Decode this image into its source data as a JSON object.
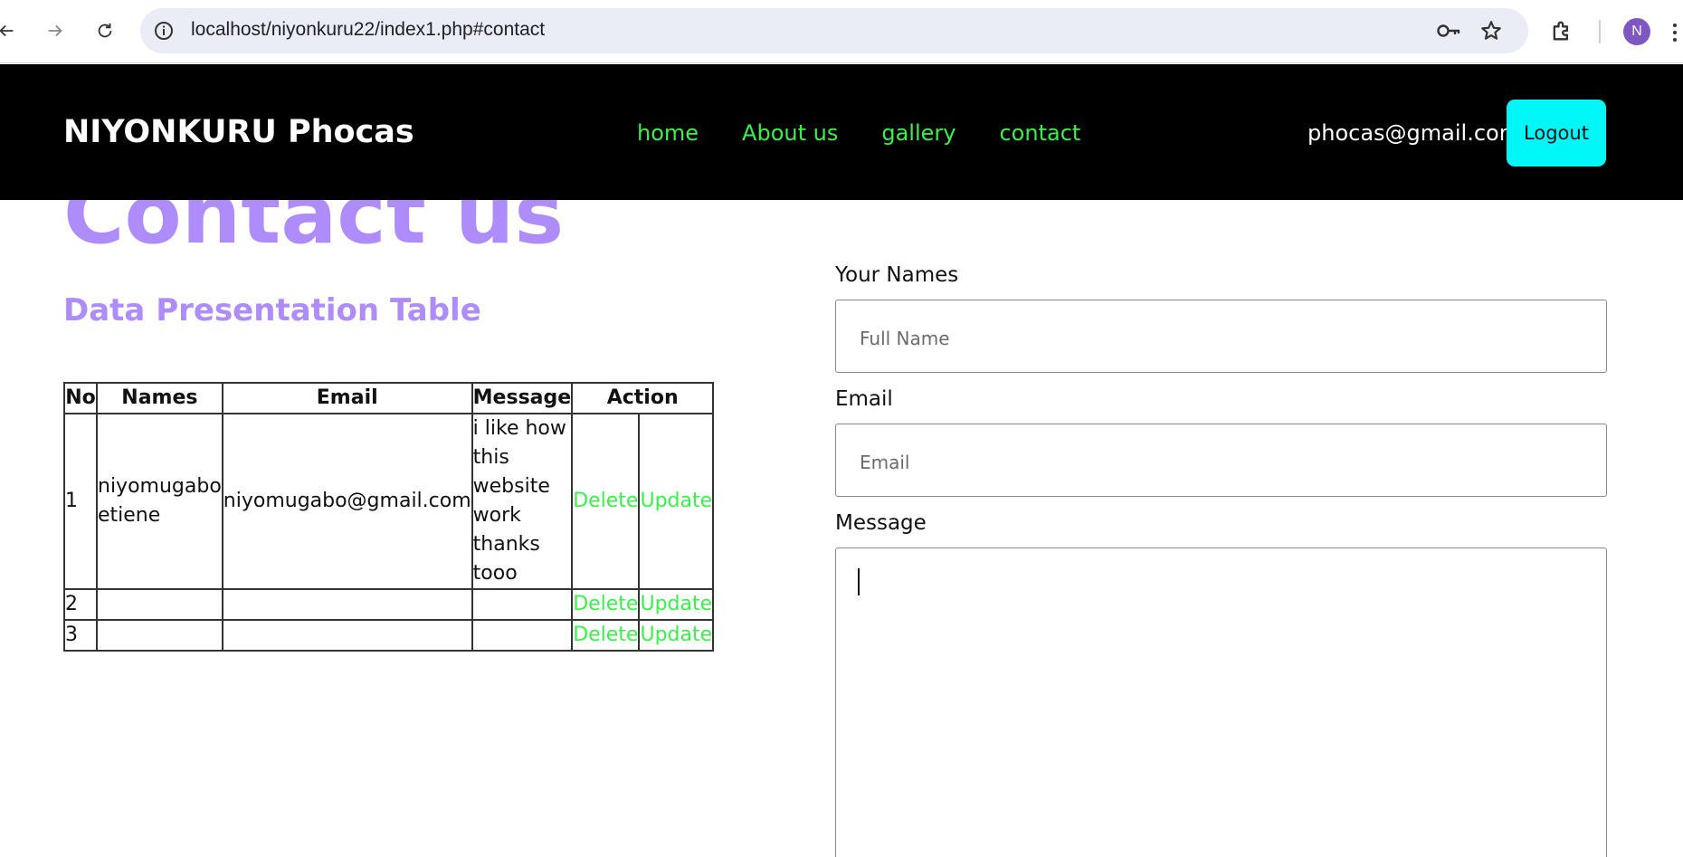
{
  "browser": {
    "url": "localhost/niyonkuru22/index1.php#contact",
    "profile_initial": "N",
    "icons": [
      "back-icon",
      "forward-icon",
      "reload-icon",
      "info-icon",
      "key-icon",
      "star-icon",
      "extensions-icon",
      "menu-icon"
    ]
  },
  "header": {
    "brand": "NIYONKURU Phocas",
    "nav": [
      "home",
      "About us",
      "gallery",
      "contact"
    ],
    "user_email": "phocas@gmail.com",
    "logout_label": "Logout",
    "colors": {
      "background": "#000000",
      "nav_link": "#3bf04a",
      "logout_bg": "#00f7f7"
    }
  },
  "main": {
    "title": "Contact us",
    "subtitle": "Data Presentation Table",
    "accent": "#ae8dfa",
    "table": {
      "headers": [
        "No",
        "Names",
        "Email",
        "Message",
        "Action"
      ],
      "rows": [
        {
          "no": "1",
          "names": "niyomugabo etiene",
          "email": "niyomugabo@gmail.com",
          "message": "i like how this website work thanks tooo",
          "delete": "Delete",
          "update": "Update"
        },
        {
          "no": "2",
          "names": "",
          "email": "",
          "message": "",
          "delete": "Delete",
          "update": "Update"
        },
        {
          "no": "3",
          "names": "",
          "email": "",
          "message": "",
          "delete": "Delete",
          "update": "Update"
        }
      ]
    }
  },
  "form": {
    "names_label": "Your Names",
    "names_placeholder": "Full Name",
    "email_label": "Email",
    "email_placeholder": "Email",
    "message_label": "Message",
    "message_value": ""
  }
}
